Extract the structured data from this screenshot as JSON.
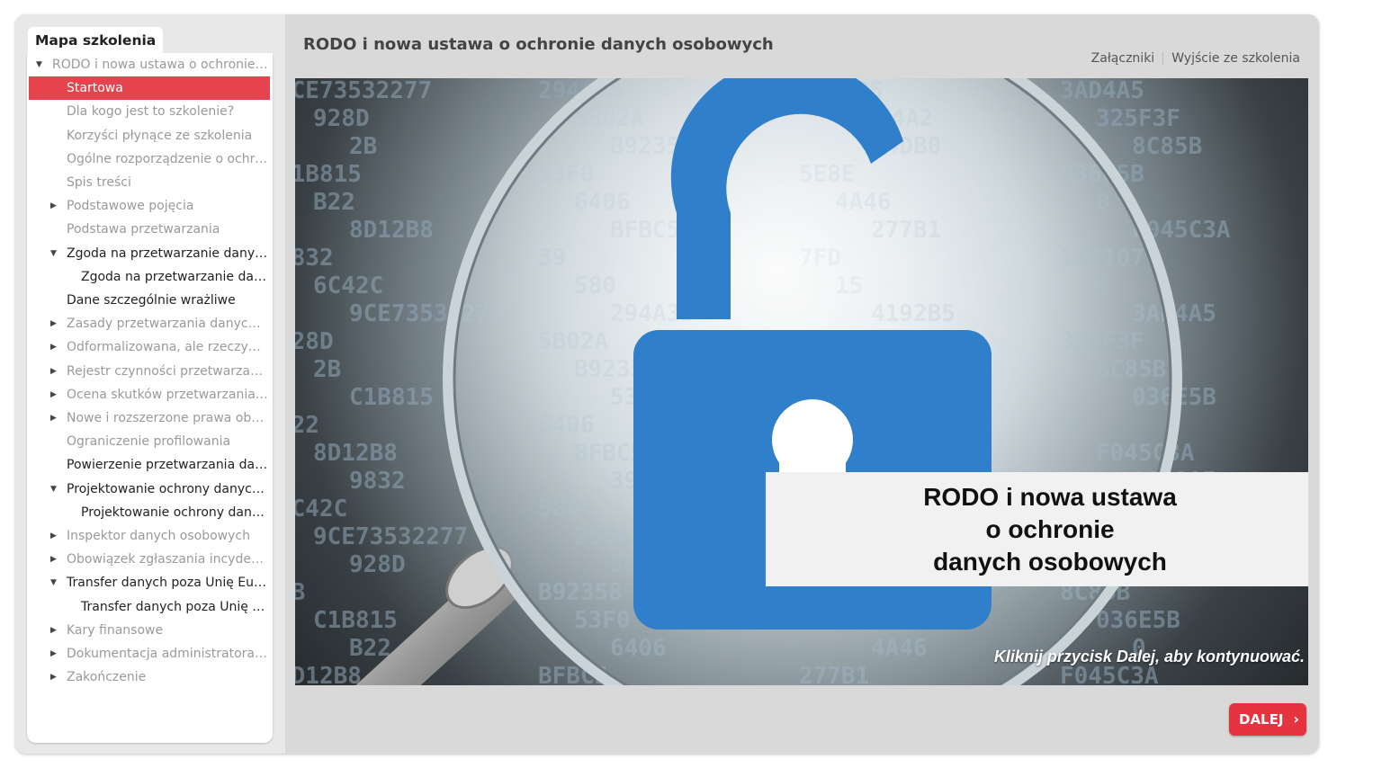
{
  "sidebar": {
    "tab_label": "Mapa szkolenia",
    "items": [
      {
        "label": "RODO i nowa ustawa o ochronie danych osobowych",
        "level": 0,
        "arrow": "down",
        "state": "normal"
      },
      {
        "label": "Startowa",
        "level": 1,
        "arrow": "",
        "state": "active"
      },
      {
        "label": "Dla kogo jest to szkolenie?",
        "level": 1,
        "arrow": "",
        "state": "normal"
      },
      {
        "label": "Korzyści płynące ze szkolenia",
        "level": 1,
        "arrow": "",
        "state": "normal"
      },
      {
        "label": "Ogólne rozporządzenie o ochronie danych",
        "level": 1,
        "arrow": "",
        "state": "normal"
      },
      {
        "label": "Spis treści",
        "level": 1,
        "arrow": "",
        "state": "normal"
      },
      {
        "label": "Podstawowe pojęcia",
        "level": 1,
        "arrow": "right",
        "state": "normal"
      },
      {
        "label": "Podstawa przetwarzania",
        "level": 1,
        "arrow": "",
        "state": "normal"
      },
      {
        "label": "Zgoda na przetwarzanie danych osobowych",
        "level": 1,
        "arrow": "down",
        "state": "dark"
      },
      {
        "label": "Zgoda na przetwarzanie danych osobowych",
        "level": 2,
        "arrow": "",
        "state": "dark"
      },
      {
        "label": "Dane szczególnie wrażliwe",
        "level": 1,
        "arrow": "",
        "state": "dark"
      },
      {
        "label": "Zasady przetwarzania danych osobowych",
        "level": 1,
        "arrow": "right",
        "state": "normal"
      },
      {
        "label": "Odformalizowana, ale rzeczywista ochrona",
        "level": 1,
        "arrow": "right",
        "state": "normal"
      },
      {
        "label": "Rejestr czynności przetwarzania danych",
        "level": 1,
        "arrow": "right",
        "state": "normal"
      },
      {
        "label": "Ocena skutków przetwarzania danych",
        "level": 1,
        "arrow": "right",
        "state": "normal"
      },
      {
        "label": "Nowe i rozszerzone prawa obywateli",
        "level": 1,
        "arrow": "right",
        "state": "normal"
      },
      {
        "label": "Ograniczenie profilowania",
        "level": 1,
        "arrow": "",
        "state": "normal"
      },
      {
        "label": "Powierzenie przetwarzania danych osobowych",
        "level": 1,
        "arrow": "",
        "state": "dark"
      },
      {
        "label": "Projektowanie ochrony danych osobowych",
        "level": 1,
        "arrow": "down",
        "state": "dark"
      },
      {
        "label": "Projektowanie ochrony danych osobowych",
        "level": 2,
        "arrow": "",
        "state": "dark"
      },
      {
        "label": "Inspektor danych osobowych",
        "level": 1,
        "arrow": "right",
        "state": "normal"
      },
      {
        "label": "Obowiązek zgłaszania incydentów",
        "level": 1,
        "arrow": "right",
        "state": "normal"
      },
      {
        "label": "Transfer danych poza Unię Europejską",
        "level": 1,
        "arrow": "down",
        "state": "dark"
      },
      {
        "label": "Transfer danych poza Unię Europejską",
        "level": 2,
        "arrow": "",
        "state": "dark"
      },
      {
        "label": "Kary finansowe",
        "level": 1,
        "arrow": "right",
        "state": "normal"
      },
      {
        "label": "Dokumentacja administratora i podmiotu",
        "level": 1,
        "arrow": "right",
        "state": "normal"
      },
      {
        "label": "Zakończenie",
        "level": 1,
        "arrow": "right",
        "state": "normal"
      }
    ]
  },
  "header": {
    "title": "RODO i nowa ustawa o ochronie danych osobowych",
    "attachments_label": "Załączniki",
    "exit_label": "Wyjście ze szkolenia"
  },
  "slide": {
    "title_lines": [
      "RODO i nowa ustawa",
      "o ochronie",
      "danych osobowych"
    ],
    "hint": "Kliknij przycisk Dalej, aby kontynuować.",
    "image_icons": [
      "padlock-open-icon",
      "magnifying-glass-icon"
    ],
    "hex_text": [
      "9CE73532277",
      "294A3B",
      "4192B5",
      "3AD4A5",
      "928D",
      "5B02A",
      "C3AC4A2",
      "325F3F",
      "2B",
      "B92358",
      "D4DB0",
      "8C85B",
      "C1B815",
      "53F0",
      "5E8E",
      "036E5B",
      "B22",
      "6406",
      "4A46",
      "0",
      "8D12B8",
      "BFBC5",
      "277B1",
      "F045C3A",
      "9832",
      "39",
      "7FD",
      "118107",
      "6C42C",
      "580",
      "15",
      "6"
    ],
    "colors": {
      "lock": "#2f7fcb",
      "accent": "#e5444f"
    }
  },
  "next_button": {
    "label": "DALEJ",
    "chevron": "›"
  }
}
